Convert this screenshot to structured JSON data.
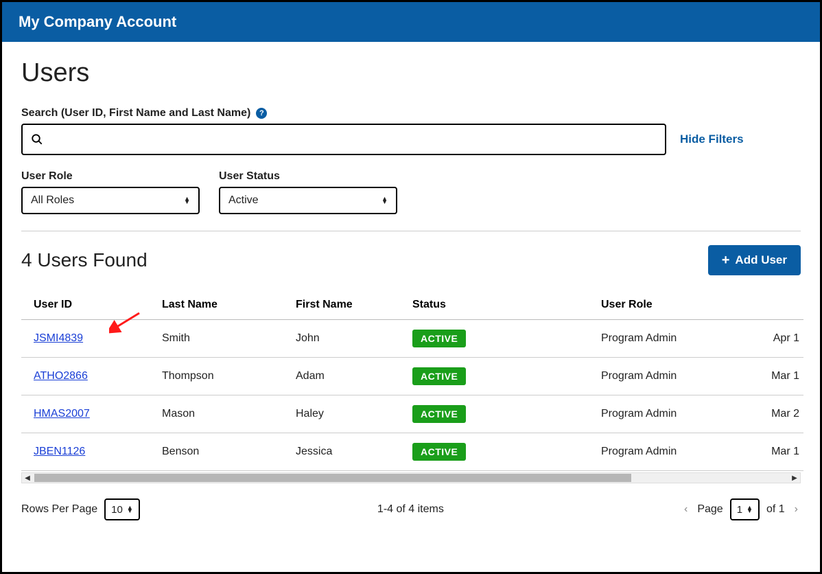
{
  "header": {
    "title": "My Company Account"
  },
  "page": {
    "title": "Users"
  },
  "search": {
    "label": "Search (User ID, First Name and Last Name)",
    "placeholder": "",
    "hide_filters": "Hide Filters"
  },
  "filters": {
    "role": {
      "label": "User Role",
      "selected": "All Roles"
    },
    "status": {
      "label": "User Status",
      "selected": "Active"
    }
  },
  "results": {
    "count_text": "4 Users Found",
    "add_user_label": "Add User"
  },
  "table": {
    "headers": {
      "user_id": "User ID",
      "last_name": "Last Name",
      "first_name": "First Name",
      "status": "Status",
      "user_role": "User Role",
      "date": ""
    },
    "rows": [
      {
        "user_id": "JSMI4839",
        "last_name": "Smith",
        "first_name": "John",
        "status": "ACTIVE",
        "user_role": "Program Admin",
        "date": "Apr 1"
      },
      {
        "user_id": "ATHO2866",
        "last_name": "Thompson",
        "first_name": "Adam",
        "status": "ACTIVE",
        "user_role": "Program Admin",
        "date": "Mar 1"
      },
      {
        "user_id": "HMAS2007",
        "last_name": "Mason",
        "first_name": "Haley",
        "status": "ACTIVE",
        "user_role": "Program Admin",
        "date": "Mar 2"
      },
      {
        "user_id": "JBEN1126",
        "last_name": "Benson",
        "first_name": "Jessica",
        "status": "ACTIVE",
        "user_role": "Program Admin",
        "date": "Mar 1"
      }
    ]
  },
  "pagination": {
    "rows_label": "Rows Per Page",
    "rows_value": "10",
    "range_text": "1-4 of 4 items",
    "page_label": "Page",
    "page_value": "1",
    "of_text": "of 1"
  }
}
